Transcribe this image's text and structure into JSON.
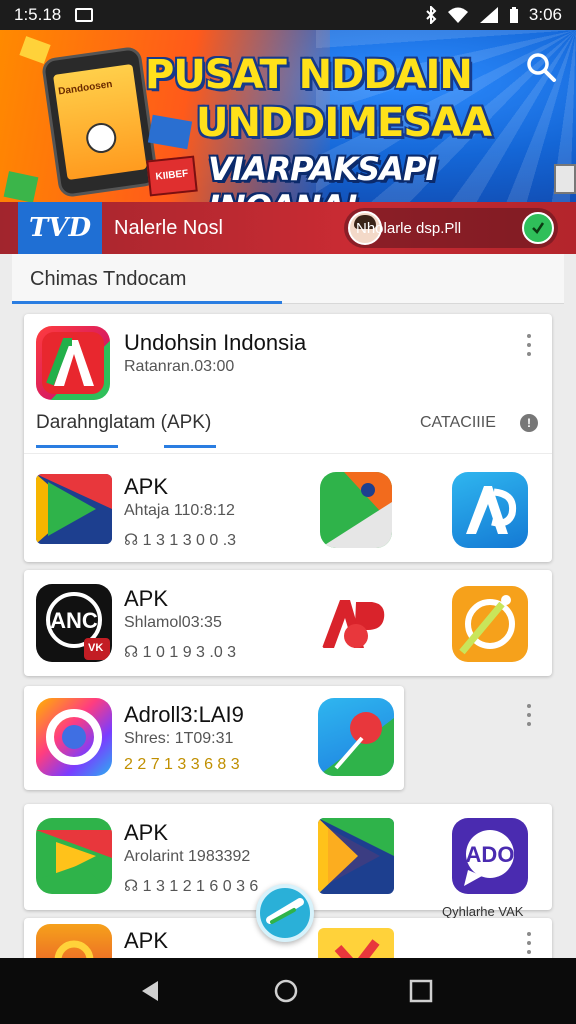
{
  "status_bar": {
    "time": "1:5.18",
    "right_time": "3:06",
    "icons": [
      "notification-icon",
      "bluetooth-icon",
      "wifi-icon",
      "signal-icon",
      "battery-icon"
    ]
  },
  "banner": {
    "title_line1": "PUSAT NDDAIN",
    "title_line2": "UNDDIMESAA",
    "title_line3": "VIARPAKSAPI INOANA!",
    "phone_label": "Dandoosen",
    "box_label": "KIIBEF"
  },
  "nav": {
    "logo_text": "TVD",
    "title": "Nalerle Nosl",
    "account_name": "Nholarle dsp.Pll"
  },
  "page": {
    "section_title": "Chimas Tndocam"
  },
  "featured": {
    "name": "Undohsin Indonsia",
    "subtitle": "Ratanran.03:00",
    "tab_left": "Darahnglatam (APK)",
    "tab_right": "CATACIIIE",
    "info_label": "!"
  },
  "rows": [
    {
      "name": "APK",
      "subtitle": "Ahtaja 110:8:12",
      "meta": "☊ 1 3   1 3 0 0 .3"
    },
    {
      "name": "APK",
      "subtitle": "Shlamol03:35",
      "meta": "☊ 1 0   1 9 3 .0 3"
    },
    {
      "name": "Adroll3:LAI9",
      "subtitle": "Shres: 1T09:31",
      "meta": "2 2 7   1 3 3 6 8 3"
    },
    {
      "name": "APK",
      "subtitle": "Arolarint 1983392",
      "meta": "☊ 1 3   1 2 1 6 0 3 6"
    },
    {
      "name": "APK"
    }
  ],
  "side_label": "Qyhlarhe VAK",
  "badge_vk": "VK",
  "colors": {
    "accent_blue": "#2a7de1",
    "nav_red": "#c92b33",
    "banner_yellow": "#ffe11a"
  }
}
